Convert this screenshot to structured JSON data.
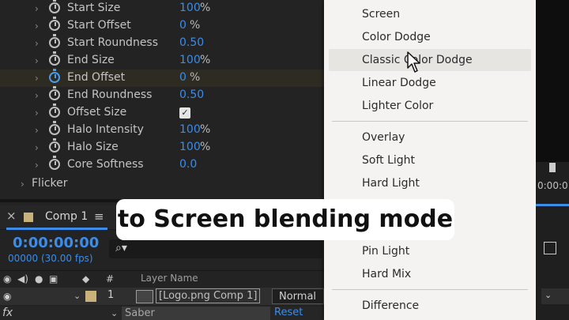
{
  "effect_properties": [
    {
      "label": "Start Size",
      "value": "100",
      "unit": "%"
    },
    {
      "label": "Start Offset",
      "value": "0",
      "unit": "%"
    },
    {
      "label": "Start Roundness",
      "value": "0.50",
      "unit": ""
    },
    {
      "label": "End Size",
      "value": "100",
      "unit": "%"
    },
    {
      "label": "End Offset",
      "value": "0",
      "unit": "%"
    },
    {
      "label": "End Roundness",
      "value": "0.50",
      "unit": ""
    },
    {
      "label": "Offset Size",
      "value": "",
      "unit": "",
      "checked": true
    },
    {
      "label": "Halo Intensity",
      "value": "100",
      "unit": "%"
    },
    {
      "label": "Halo Size",
      "value": "100",
      "unit": "%"
    },
    {
      "label": "Core Softness",
      "value": "0.0",
      "unit": ""
    }
  ],
  "flicker_label": "Flicker",
  "comp": {
    "tab_label": "Comp 1",
    "timecode": "0:00:00:00",
    "fps": "00000 (30.00 fps)",
    "layer_header": "Layer Name",
    "hash_header": "#",
    "layer_number": "1",
    "layer_name": "[Logo.png Comp 1]",
    "blend_mode": "Normal",
    "fx_label": "fx",
    "effect_name": "Saber",
    "reset_label": "Reset",
    "accent_color": "#3c8ce8"
  },
  "right_panel": {
    "timecode_partial": "0:00:0"
  },
  "blend_menu": {
    "group_1": [
      "Screen",
      "Color Dodge",
      "Classic Color Dodge",
      "Linear Dodge",
      "Lighter Color"
    ],
    "group_2": [
      "Overlay",
      "Soft Light",
      "Hard Light",
      "Pin Light",
      "Hard Mix"
    ],
    "group_3": [
      "Difference"
    ],
    "hovered": "Classic Color Dodge"
  },
  "caption": "to Screen blending mode"
}
